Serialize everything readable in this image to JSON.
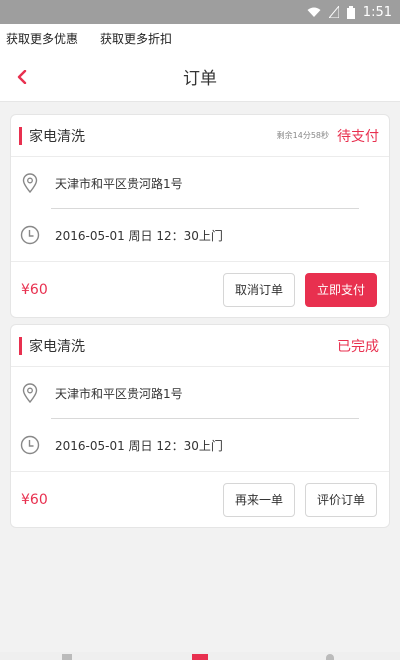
{
  "status_bar": {
    "time": "1:51"
  },
  "promo": {
    "item1": "获取更多优惠",
    "item2": "获取更多折扣"
  },
  "header": {
    "title": "订单"
  },
  "colors": {
    "accent": "#e8304f"
  },
  "orders": [
    {
      "service": "家电清洗",
      "timer": "剩余14分58秒",
      "status": "待支付",
      "address": "天津市和平区贵河路1号",
      "time": "2016-05-01  周日  12：30上门",
      "price": "¥60",
      "buttons": [
        "取消订单",
        "立即支付"
      ]
    },
    {
      "service": "家电清洗",
      "status": "已完成",
      "address": "天津市和平区贵河路1号",
      "time": "2016-05-01  周日  12：30上门",
      "price": "¥60",
      "buttons": [
        "再来一单",
        "评价订单"
      ]
    }
  ]
}
